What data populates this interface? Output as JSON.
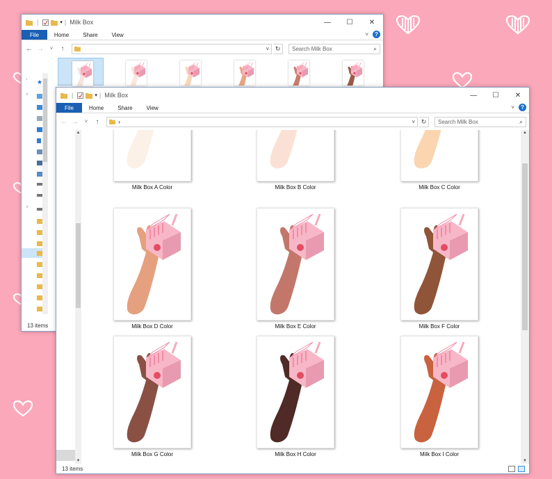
{
  "window_back": {
    "title": "Milk Box",
    "tabs": [
      {
        "label": "File"
      },
      {
        "label": "Home"
      },
      {
        "label": "Share"
      },
      {
        "label": "View"
      }
    ],
    "search_placeholder": "Search Milk Box",
    "status": "13 items",
    "thumb_skin_colors": [
      "#f6e4dc",
      "#fbe7dd",
      "#f8d5b8",
      "#e8a383",
      "#c97b6e",
      "#9a5a48"
    ]
  },
  "window_front": {
    "title": "Milk Box",
    "tabs": [
      {
        "label": "File"
      },
      {
        "label": "Home"
      },
      {
        "label": "Share"
      },
      {
        "label": "View"
      }
    ],
    "breadcrumb_sep": "›",
    "search_placeholder": "Search Milk Box",
    "status": "13 items",
    "files": [
      {
        "label": "Milk Box A Color",
        "skin": "#fbf1e6"
      },
      {
        "label": "Milk Box B Color",
        "skin": "#fbe1d5"
      },
      {
        "label": "Milk Box C Color",
        "skin": "#fbd5b0"
      },
      {
        "label": "Milk Box D Color",
        "skin": "#e5a07f"
      },
      {
        "label": "Milk Box E Color",
        "skin": "#c2776a"
      },
      {
        "label": "Milk Box F Color",
        "skin": "#905438"
      },
      {
        "label": "Milk Box G Color",
        "skin": "#8a5044"
      },
      {
        "label": "Milk Box H Color",
        "skin": "#4f2a27"
      },
      {
        "label": "Milk Box I Color",
        "skin": "#c8623f"
      }
    ]
  },
  "colors": {
    "background": "#fba8ba",
    "accent": "#1a5fb4",
    "carton_pink": "#f7b7c6"
  }
}
